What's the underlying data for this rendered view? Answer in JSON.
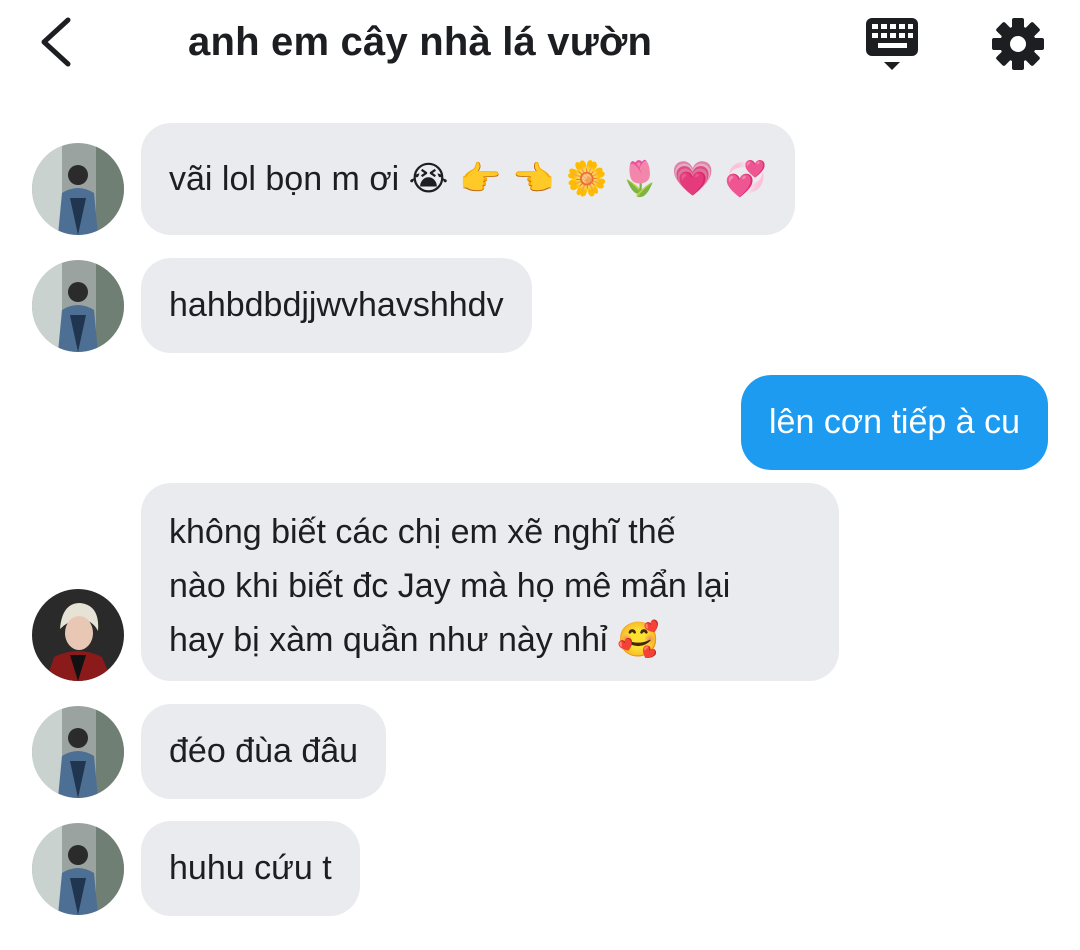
{
  "header": {
    "title": "anh em cây nhà lá vườn"
  },
  "icons": {
    "back": "chevron-left-icon",
    "keyboard": "keyboard-icon",
    "settings": "gear-icon"
  },
  "colors": {
    "sent_bubble": "#1d9bf0",
    "received_bubble": "#e9ebee",
    "text": "#1c1e21"
  },
  "messages": [
    {
      "sender": "other",
      "avatar": "friend-a",
      "text": "vãi lol bọn m ơi",
      "emojis": "😭 👉 👈 🌼 🌷 💗 💞"
    },
    {
      "sender": "other",
      "avatar": "friend-a",
      "text": "hahbdbdjjwvhavshhdv"
    },
    {
      "sender": "me",
      "text": "lên cơn tiếp à cu"
    },
    {
      "sender": "other",
      "avatar": "friend-b",
      "lines": [
        "không biết các chị em xẽ nghĩ thế",
        "nào khi biết đc Jay mà họ mê mẩn lại",
        "hay bị xàm quần như này nhỉ"
      ],
      "emojis": "🥰"
    },
    {
      "sender": "other",
      "avatar": "friend-a",
      "text": "đéo đùa đâu"
    },
    {
      "sender": "other",
      "avatar": "friend-a",
      "text": "huhu cứu t"
    }
  ]
}
